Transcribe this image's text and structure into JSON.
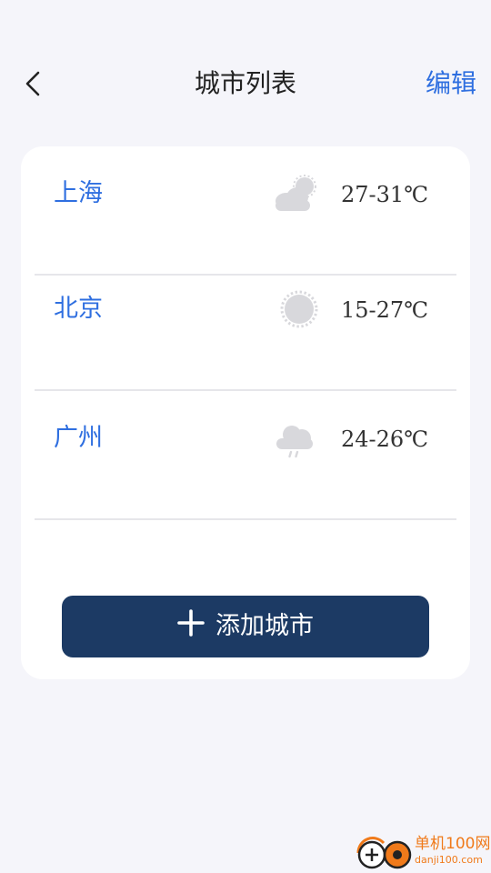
{
  "header": {
    "title": "城市列表",
    "edit_label": "编辑"
  },
  "cities": [
    {
      "name": "上海",
      "weather_icon": "cloudy-icon",
      "temp": "27-31℃"
    },
    {
      "name": "北京",
      "weather_icon": "sun-icon",
      "temp": "15-27℃"
    },
    {
      "name": "广州",
      "weather_icon": "rain-icon",
      "temp": "24-26℃"
    }
  ],
  "add_button": {
    "label": "添加城市"
  },
  "watermark": {
    "title": "单机100网",
    "url": "danji100.com"
  },
  "colors": {
    "accent": "#2f6fe0",
    "button": "#1c3a64",
    "background": "#f5f5fa",
    "icon_gray": "#d8d8dc",
    "watermark": "#f07a1a"
  }
}
